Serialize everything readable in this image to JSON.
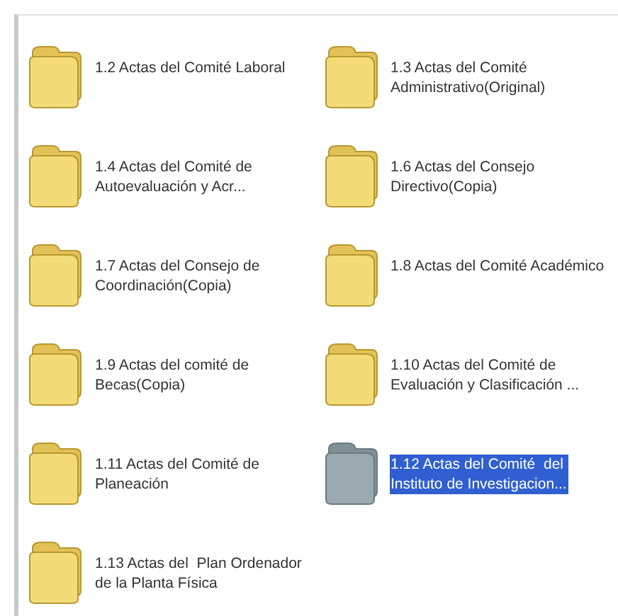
{
  "folders": [
    {
      "lines": [
        "1.2 Actas del Comité Laboral"
      ],
      "selected": false
    },
    {
      "lines": [
        "1.3 Actas del Comité",
        "Administrativo(Original)"
      ],
      "selected": false
    },
    {
      "lines": [
        "1.4 Actas del Comité de",
        "Autoevaluación y Acr..."
      ],
      "selected": false
    },
    {
      "lines": [
        "1.6 Actas del Consejo",
        "Directivo(Copia)"
      ],
      "selected": false
    },
    {
      "lines": [
        "1.7 Actas del Consejo de",
        "Coordinación(Copia)"
      ],
      "selected": false
    },
    {
      "lines": [
        "1.8 Actas del Comité Académico"
      ],
      "selected": false
    },
    {
      "lines": [
        "1.9 Actas del comité de",
        "Becas(Copia)"
      ],
      "selected": false
    },
    {
      "lines": [
        "1.10 Actas del Comité de",
        "Evaluación y Clasificación ..."
      ],
      "selected": false
    },
    {
      "lines": [
        "1.11 Actas del Comité de",
        "Planeación"
      ],
      "selected": false
    },
    {
      "lines": [
        "1.12 Actas del Comité  del",
        "Instituto de Investigacion..."
      ],
      "selected": true
    },
    {
      "lines": [
        "1.13 Actas del  Plan Ordenador",
        "de la Planta Física"
      ],
      "selected": false
    }
  ]
}
